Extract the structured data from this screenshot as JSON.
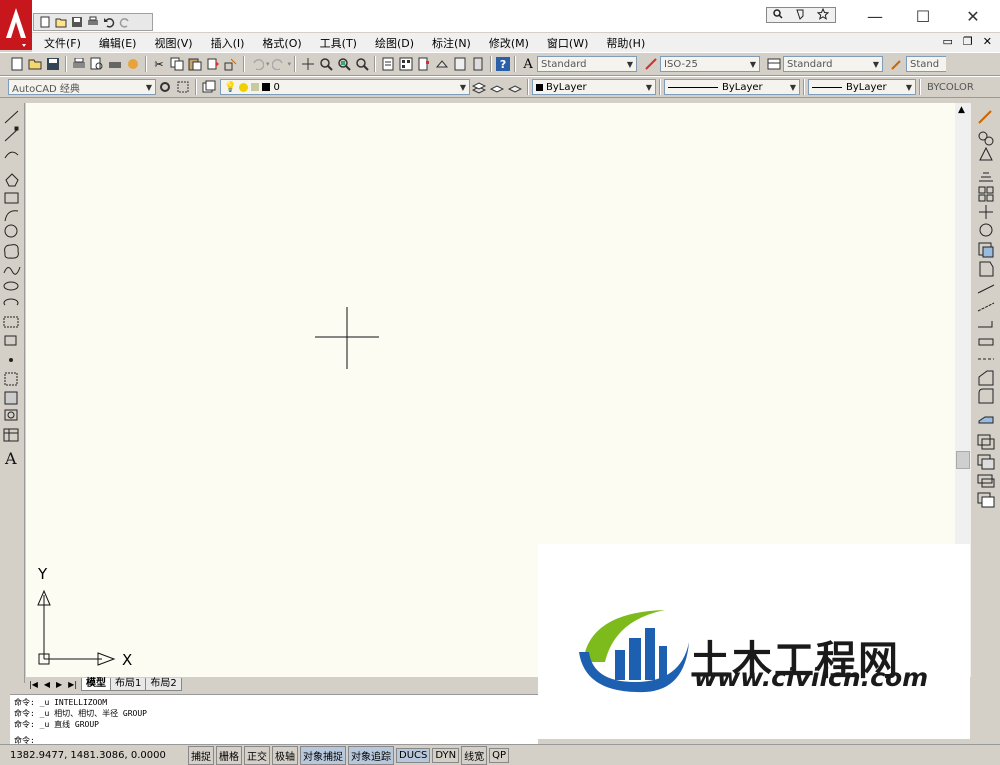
{
  "menu": [
    "文件(F)",
    "编辑(E)",
    "视图(V)",
    "插入(I)",
    "格式(O)",
    "工具(T)",
    "绘图(D)",
    "标注(N)",
    "修改(M)",
    "窗口(W)",
    "帮助(H)"
  ],
  "toolbar_styles": {
    "text_style": "Standard",
    "dim_style": "ISO-25",
    "table_style": "Standard",
    "multileader_style": "Stand"
  },
  "workspace": "AutoCAD 经典",
  "layer": {
    "name": "0"
  },
  "properties": {
    "color": "ByLayer",
    "linetype": "ByLayer",
    "lineweight": "ByLayer",
    "plot_style": "BYCOLOR"
  },
  "ucs": {
    "x_label": "X",
    "y_label": "Y"
  },
  "layout_tabs": [
    "模型",
    "布局1",
    "布局2"
  ],
  "command_history": [
    "命令: _u INTELLIZOOM",
    "命令: _u 相切、相切、半径 GROUP",
    "命令: _u 直线 GROUP"
  ],
  "command_prompt": "命令:",
  "coordinates": "1382.9477,  1481.3086,  0.0000",
  "status_buttons": [
    {
      "label": "捕捉",
      "on": false
    },
    {
      "label": "栅格",
      "on": false
    },
    {
      "label": "正交",
      "on": false
    },
    {
      "label": "极轴",
      "on": false
    },
    {
      "label": "对象捕捉",
      "on": true
    },
    {
      "label": "对象追踪",
      "on": true
    },
    {
      "label": "DUCS",
      "on": true
    },
    {
      "label": "DYN",
      "on": false
    },
    {
      "label": "线宽",
      "on": false
    },
    {
      "label": "QP",
      "on": false
    }
  ],
  "watermark": {
    "brand_cn": "土木工程网",
    "url": "www.civilcn.com"
  },
  "colors": {
    "canvas": "#fdfcf3",
    "logo_red": "#c8161d",
    "wm_blue": "#1d5fb0",
    "wm_green": "#7dbb1c"
  }
}
